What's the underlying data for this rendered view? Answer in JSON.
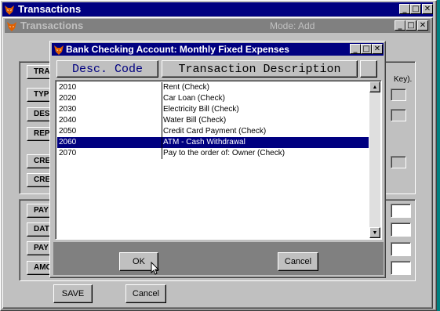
{
  "main_window": {
    "title": "Transactions"
  },
  "sub_window": {
    "title": "Transactions",
    "mode": "Mode: Add"
  },
  "side_labels": [
    "TRAN",
    "TYPE",
    "DESC",
    "REPO",
    "CRED",
    "CRED",
    "PAY",
    "DATE",
    "PAY",
    "AMO"
  ],
  "key_hint": "Key).",
  "bottom_buttons": {
    "save": "SAVE",
    "cancel": "Cancel"
  },
  "dialog": {
    "title": "Bank Checking Account: Monthly Fixed Expenses",
    "col_code": "Desc. Code",
    "col_desc": "Transaction Description",
    "rows": [
      {
        "code": "2010",
        "desc": "Rent  (Check)",
        "selected": false
      },
      {
        "code": "2020",
        "desc": "Car Loan  (Check)",
        "selected": false
      },
      {
        "code": "2030",
        "desc": "Electricity Bill  (Check)",
        "selected": false
      },
      {
        "code": "2040",
        "desc": "Water Bill  (Check)",
        "selected": false
      },
      {
        "code": "2050",
        "desc": "Credit Card Payment  (Check)",
        "selected": false
      },
      {
        "code": "2060",
        "desc": "ATM - Cash Withdrawal",
        "selected": true
      },
      {
        "code": "2070",
        "desc": "Pay to the order of: Owner  (Check)",
        "selected": false
      }
    ],
    "ok": "OK",
    "cancel": "Cancel"
  },
  "colors": {
    "active_title": "#000080",
    "inactive_title": "#808080",
    "face": "#c0c0c0",
    "desktop": "#008080"
  }
}
